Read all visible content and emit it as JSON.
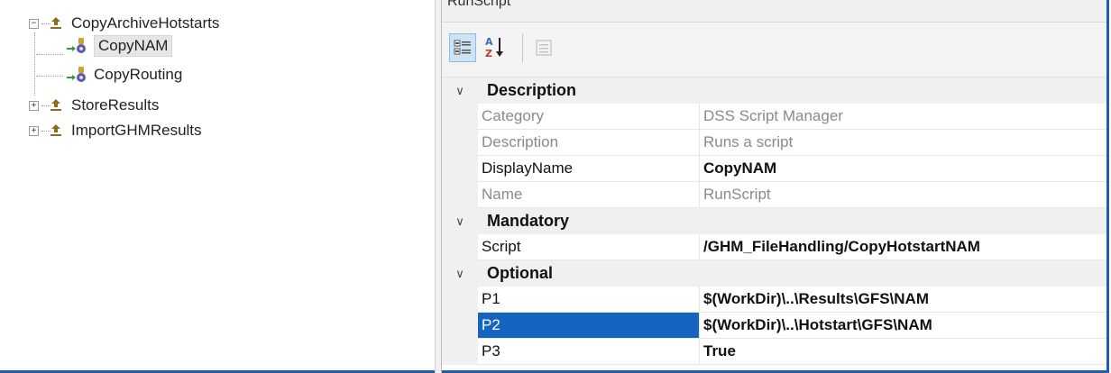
{
  "tree": {
    "nodes": [
      {
        "label": "CopyArchiveHotstarts",
        "expander": "−"
      },
      {
        "label": "CopyNAM"
      },
      {
        "label": "CopyRouting"
      },
      {
        "label": "StoreResults",
        "expander": "+"
      },
      {
        "label": "ImportGHMResults",
        "expander": "+"
      }
    ]
  },
  "pane": {
    "title": "RunScript",
    "toolbar": {
      "categorized": "categorized-icon",
      "alphabetical": "alphabetical-icon",
      "property_pages": "property-pages-icon"
    }
  },
  "properties": {
    "categories": [
      {
        "label": "Description",
        "rows": [
          {
            "name": "Category",
            "value": "DSS Script Manager"
          },
          {
            "name": "Description",
            "value": "Runs a script"
          },
          {
            "name": "DisplayName",
            "value": "CopyNAM"
          },
          {
            "name": "Name",
            "value": "RunScript"
          }
        ]
      },
      {
        "label": "Mandatory",
        "rows": [
          {
            "name": "Script",
            "value": "/GHM_FileHandling/CopyHotstartNAM"
          }
        ]
      },
      {
        "label": "Optional",
        "rows": [
          {
            "name": "P1",
            "value": "$(WorkDir)\\..\\Results\\GFS\\NAM"
          },
          {
            "name": "P2",
            "value": "$(WorkDir)\\..\\Hotstart\\GFS\\NAM"
          },
          {
            "name": "P3",
            "value": "True"
          }
        ]
      }
    ]
  },
  "colors": {
    "selection": "#1565c0",
    "category_bg": "#f0f0f0",
    "frame_border": "#1f5fa8"
  }
}
